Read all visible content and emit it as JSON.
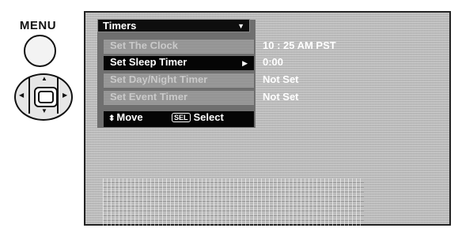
{
  "remote": {
    "menu_label": "MENU",
    "menu_button_icon": "round-button-icon",
    "dpad_icon": "directional-pad-icon"
  },
  "osd": {
    "title": "Timers",
    "title_dropdown_icon": "triangle-down-icon",
    "items": [
      {
        "label": "Set The Clock",
        "value": "10 : 25 AM PST",
        "state": "dimmed"
      },
      {
        "label": "Set Sleep Timer",
        "value": "0:00",
        "state": "selected",
        "arrow_icon": "triangle-right-icon"
      },
      {
        "label": "Set Day/Night Timer",
        "value": "Not Set",
        "state": "dimmed"
      },
      {
        "label": "Set Event Timer",
        "value": "Not Set",
        "state": "dimmed"
      }
    ],
    "help": {
      "move_icon": "up-down-arrows-icon",
      "move_label": "Move",
      "select_key": "SEL",
      "select_label": "Select"
    }
  },
  "colors": {
    "screen_bg": "#bdbdbd",
    "menu_bg": "#6f6f6f",
    "selected_bg": "#050505",
    "text": "#ffffff"
  }
}
